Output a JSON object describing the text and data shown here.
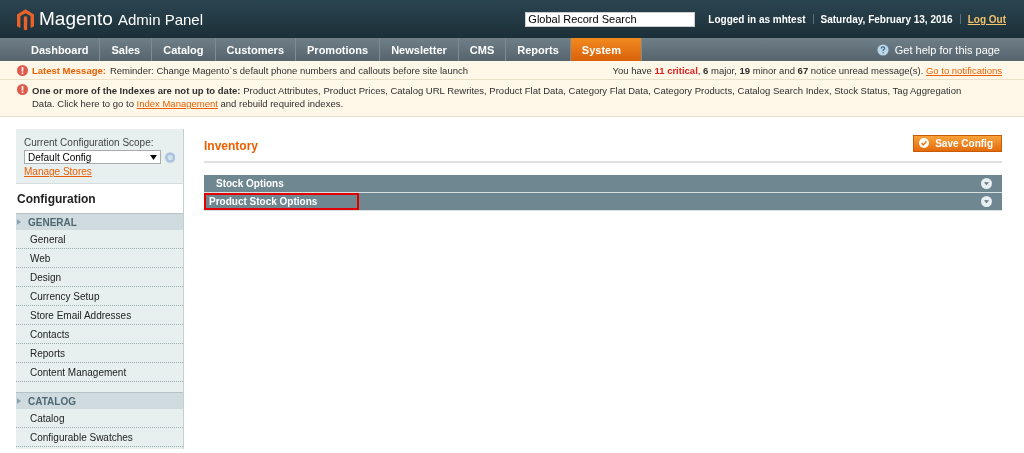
{
  "header": {
    "logo": "Magento",
    "logo_suffix": "Admin Panel",
    "search": {
      "value": "Global Record Search"
    },
    "user": "Logged in as mhtest",
    "date": "Saturday, February 13, 2016",
    "logout": "Log Out"
  },
  "nav": {
    "items": [
      {
        "label": "Dashboard",
        "selected": false
      },
      {
        "label": "Sales",
        "selected": false
      },
      {
        "label": "Catalog",
        "selected": false
      },
      {
        "label": "Customers",
        "selected": false
      },
      {
        "label": "Promotions",
        "selected": false
      },
      {
        "label": "Newsletter",
        "selected": false
      },
      {
        "label": "CMS",
        "selected": false
      },
      {
        "label": "Reports",
        "selected": false
      },
      {
        "label": "System",
        "selected": true
      }
    ],
    "help": "Get help for this page"
  },
  "latest_message": {
    "label": "Latest Message:",
    "text": "Reminder: Change Magento`s default phone numbers and callouts before site launch",
    "notice_parts": [
      {
        "kind": "plain",
        "text": "You have "
      },
      {
        "kind": "critical",
        "text": "11 critical"
      },
      {
        "kind": "plain",
        "text": ", "
      },
      {
        "kind": "bold",
        "text": "6"
      },
      {
        "kind": "plain",
        "text": " major, "
      },
      {
        "kind": "bold",
        "text": "19"
      },
      {
        "kind": "plain",
        "text": " minor and "
      },
      {
        "kind": "bold",
        "text": "67"
      },
      {
        "kind": "plain",
        "text": " notice unread message(s). "
      }
    ],
    "link": "Go to notifications"
  },
  "index_notice": {
    "text": "**One or more of the Indexes are not up to date:** Product Attributes, Product Prices, Catalog URL Rewrites, Product Flat Data, Category Flat Data, Category Products, Catalog Search Index, Stock Status, Tag Aggregation Data. Click here to go to",
    "link": "Index Management",
    "tail": "and rebuild required indexes."
  },
  "sidebar": {
    "scope_label": "Current Configuration Scope:",
    "scope_value": "Default Config",
    "manage_stores": "Manage Stores",
    "title": "Configuration",
    "sections": [
      {
        "title": "GENERAL",
        "items": [
          "General",
          "Web",
          "Design",
          "Currency Setup",
          "Store Email Addresses",
          "Contacts",
          "Reports",
          "Content Management"
        ]
      },
      {
        "title": "CATALOG",
        "items": [
          "Catalog",
          "Configurable Swatches"
        ]
      }
    ]
  },
  "main": {
    "title": "Inventory",
    "save": "Save Config",
    "groups": [
      {
        "title": "Stock Options",
        "highlighted": false
      },
      {
        "title": "Product Stock Options",
        "highlighted": true
      }
    ]
  }
}
